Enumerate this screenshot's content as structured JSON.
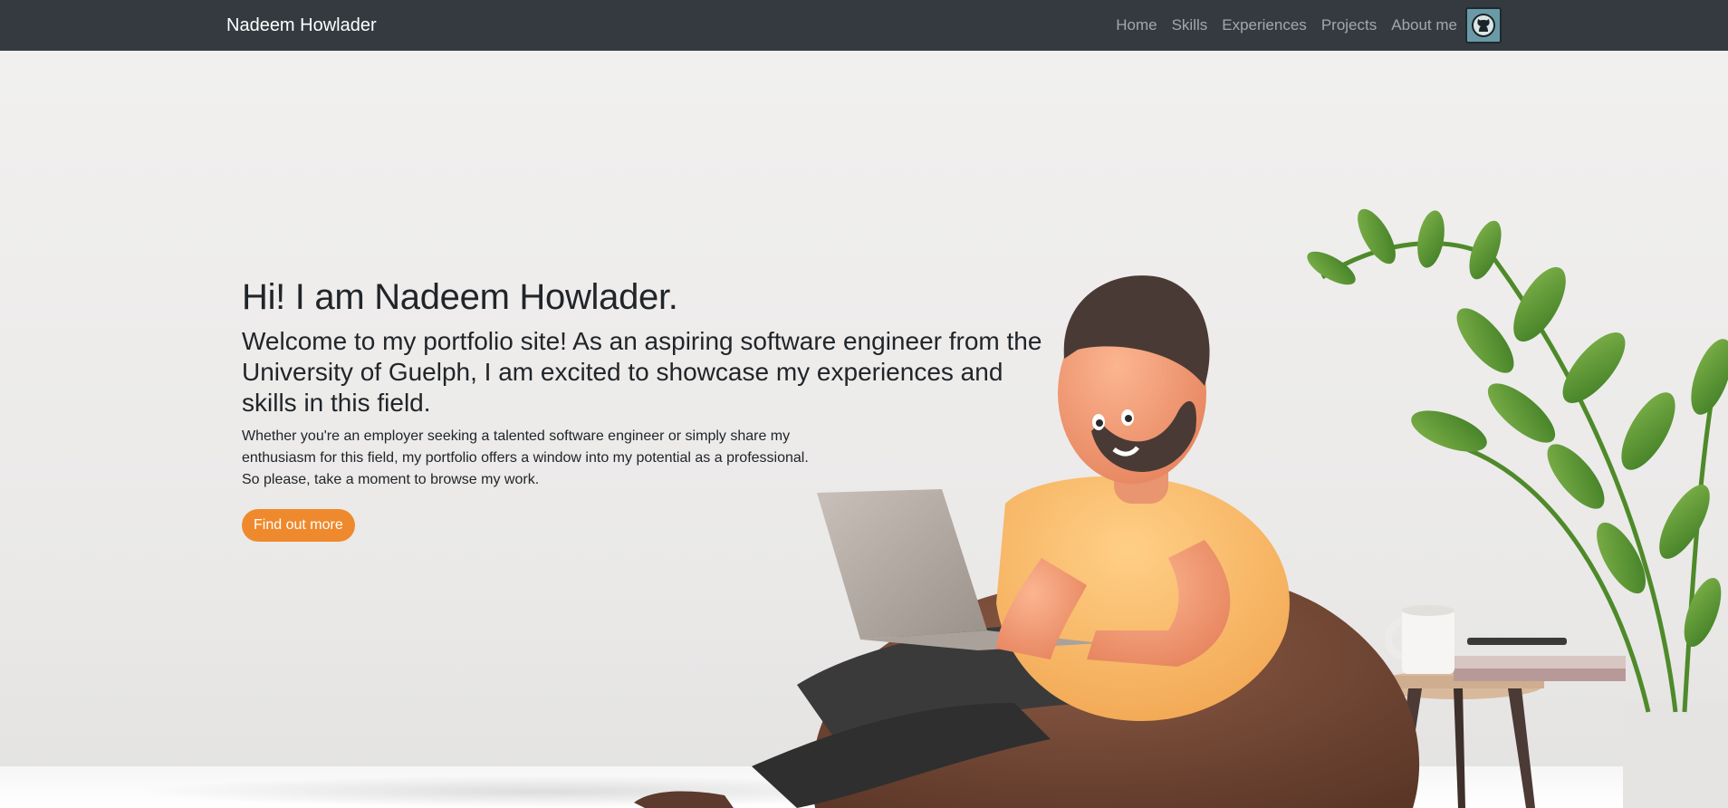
{
  "navbar": {
    "brand": "Nadeem Howlader",
    "links": [
      {
        "label": "Home"
      },
      {
        "label": "Skills"
      },
      {
        "label": "Experiences"
      },
      {
        "label": "Projects"
      },
      {
        "label": "About me"
      }
    ],
    "github_icon": "github-icon"
  },
  "hero": {
    "title": "Hi! I am Nadeem Howlader.",
    "subtitle": "Welcome to my portfolio site! As an aspiring software engineer from the University of Guelph, I am excited to showcase my experiences and skills in this field.",
    "body_lines": [
      "Whether you're an employer seeking a talented software engineer or simply share my",
      "enthusiasm for this field, my portfolio offers a window into my potential as a professional.",
      "So please, take a moment to browse my work."
    ],
    "cta_label": "Find out more",
    "image": "man-with-laptop-on-beanbag-illustration"
  },
  "colors": {
    "navbar_bg": "#343a40",
    "accent": "#ee8a2d",
    "hero_bg": "#ecebea"
  }
}
